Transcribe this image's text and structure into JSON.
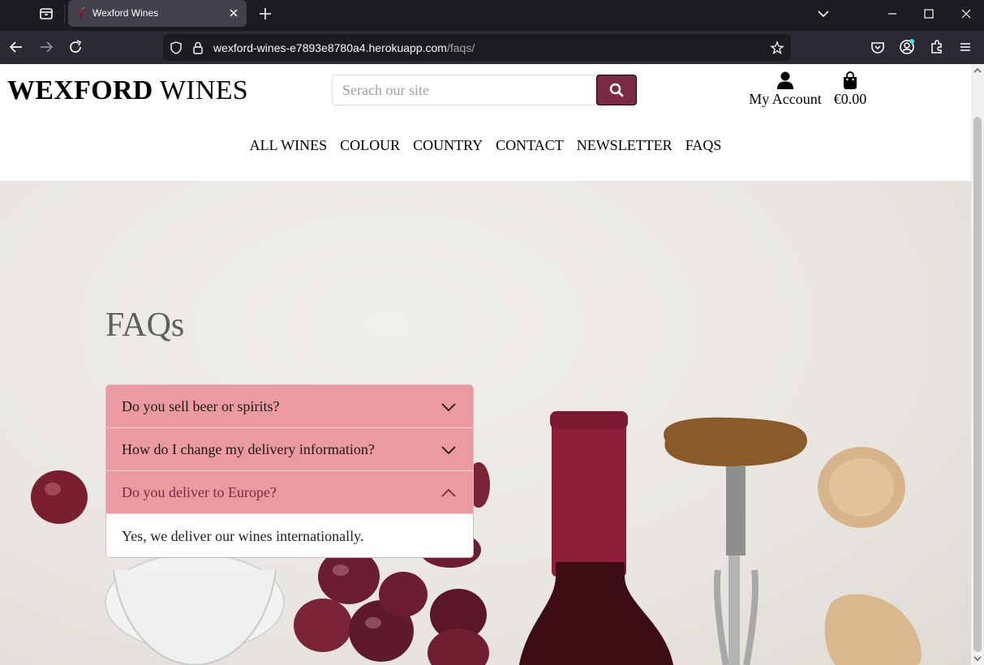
{
  "browser": {
    "tab_title": "Wexford Wines",
    "url_domain": "wexford-wines-e7893e8780a4.herokuapp.com",
    "url_path": "/faqs/"
  },
  "header": {
    "logo_bold": "WEXFORD",
    "logo_regular": "WINES",
    "search_placeholder": "Serach our site",
    "account_label": "My Account",
    "bag_total": "€0.00"
  },
  "nav": {
    "items": [
      "ALL WINES",
      "COLOUR",
      "COUNTRY",
      "CONTACT",
      "NEWSLETTER",
      "FAQS"
    ]
  },
  "faq": {
    "title": "FAQs",
    "items": [
      {
        "question": "Do you sell beer or spirits?",
        "expanded": false
      },
      {
        "question": "How do I change my delivery information?",
        "expanded": false
      },
      {
        "question": "Do you deliver to Europe?",
        "expanded": true,
        "answer": "Yes, we deliver our wines internationally."
      }
    ]
  },
  "colors": {
    "accent": "#7d2845",
    "accordion_header": "#ec9aa1"
  }
}
